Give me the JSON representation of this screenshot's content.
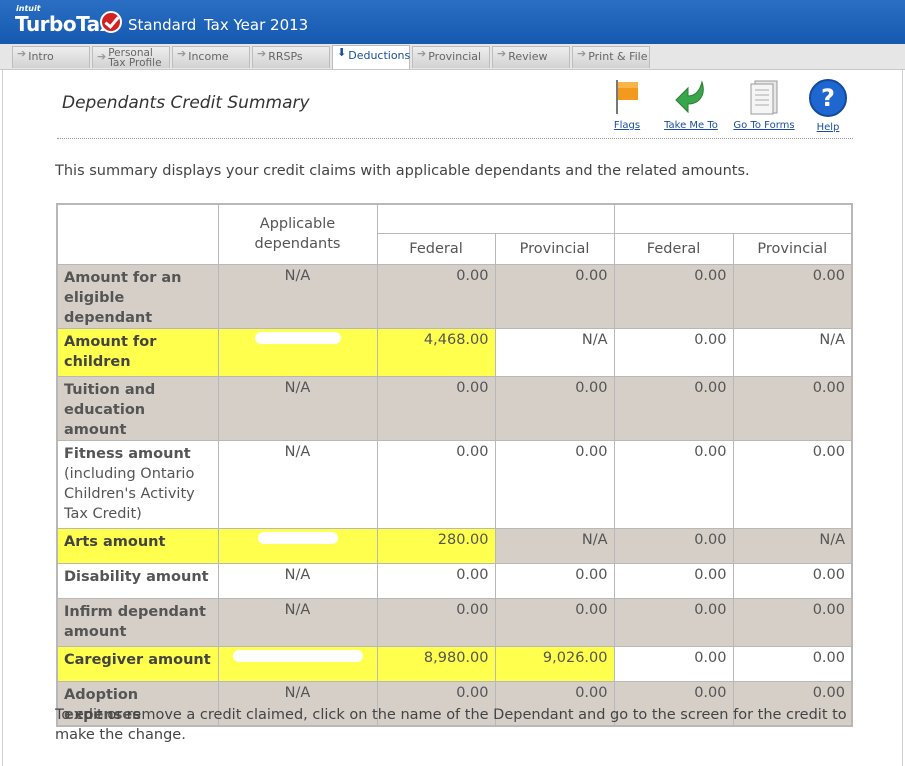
{
  "header": {
    "brand_small": "intuit",
    "brand": "TurboTax",
    "edition": "Standard",
    "tax_year": "Tax Year 2013"
  },
  "tabs": [
    {
      "label": "Intro"
    },
    {
      "label": "Personal Tax Profile",
      "line1": "Personal",
      "line2": "Tax Profile"
    },
    {
      "label": "Income"
    },
    {
      "label": "RRSPs"
    },
    {
      "label": "Deductions",
      "active": true
    },
    {
      "label": "Provincial"
    },
    {
      "label": "Review"
    },
    {
      "label": "Print & File"
    }
  ],
  "page": {
    "title": "Dependants Credit Summary",
    "intro": "This summary displays your credit claims with applicable dependants and the related amounts.",
    "footer": "To edit or remove a credit claimed, click on the name of the Dependant and go to the screen for the credit to make the change."
  },
  "tools": {
    "flags": "Flags",
    "take_me_to": "Take Me To",
    "go_to_forms": "Go To Forms",
    "help": "Help"
  },
  "table": {
    "headers": {
      "applicable": "Applicable dependants",
      "federal": "Federal",
      "provincial": "Provincial"
    },
    "rows": [
      {
        "label": "Amount for an eligible dependant",
        "dependants": "N/A",
        "fed1": "0.00",
        "prov1": "0.00",
        "fed2": "0.00",
        "prov2": "0.00"
      },
      {
        "label": "Amount for children",
        "dependants": "",
        "fed1": "4,468.00",
        "prov1": "N/A",
        "fed2": "0.00",
        "prov2": "N/A"
      },
      {
        "label": "Tuition and education amount",
        "dependants": "N/A",
        "fed1": "0.00",
        "prov1": "0.00",
        "fed2": "0.00",
        "prov2": "0.00"
      },
      {
        "label": "Fitness amount",
        "sublabel": "(including Ontario Children's Activity Tax Credit)",
        "dependants": "N/A",
        "fed1": "0.00",
        "prov1": "0.00",
        "fed2": "0.00",
        "prov2": "0.00"
      },
      {
        "label": "Arts amount",
        "dependants": "",
        "fed1": "280.00",
        "prov1": "N/A",
        "fed2": "0.00",
        "prov2": "N/A"
      },
      {
        "label": "Disability amount",
        "dependants": "N/A",
        "fed1": "0.00",
        "prov1": "0.00",
        "fed2": "0.00",
        "prov2": "0.00"
      },
      {
        "label": "Infirm dependant amount",
        "dependants": "N/A",
        "fed1": "0.00",
        "prov1": "0.00",
        "fed2": "0.00",
        "prov2": "0.00"
      },
      {
        "label": "Caregiver amount",
        "dependants": "",
        "fed1": "8,980.00",
        "prov1": "9,026.00",
        "fed2": "0.00",
        "prov2": "0.00"
      },
      {
        "label": "Adoption expenses",
        "dependants": "N/A",
        "fed1": "0.00",
        "prov1": "0.00",
        "fed2": "0.00",
        "prov2": "0.00"
      }
    ]
  },
  "colors": {
    "header_blue": "#1a5fb4",
    "highlight": "#ffff4d",
    "row_shade": "#d5cfc8",
    "link": "#1a4fa0"
  }
}
